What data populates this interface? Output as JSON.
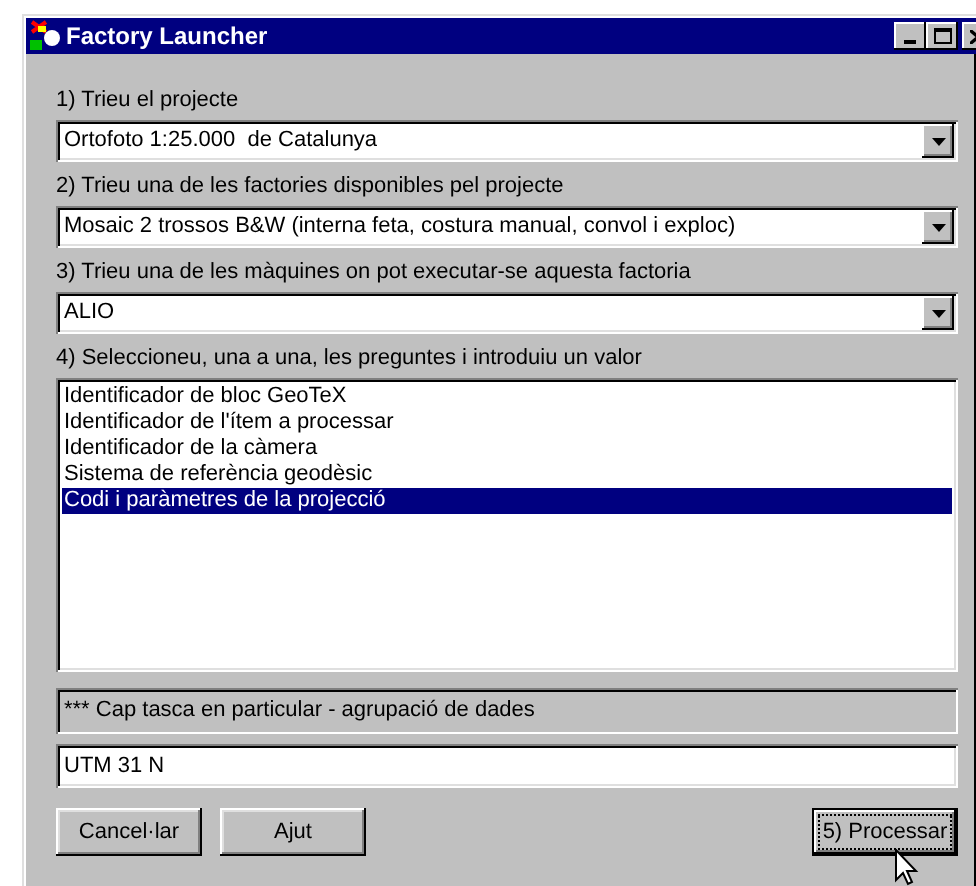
{
  "window": {
    "title": "Factory Launcher"
  },
  "steps": [
    {
      "kind": "combo",
      "label": "1) Trieu el projecte",
      "value": "Ortofoto 1:25.000  de Catalunya"
    },
    {
      "kind": "combo",
      "label": "2) Trieu una de les factories disponibles pel projecte",
      "value": "Mosaic 2 trossos B&W (interna feta, costura manual, convol i exploc)"
    },
    {
      "kind": "combo",
      "label": "3) Trieu una de les màquines on pot executar-se aquesta factoria",
      "value": "ALIO"
    },
    {
      "kind": "list",
      "label": "4) Seleccioneu, una a una, les preguntes i introduiu un valor",
      "items": [
        {
          "text": "Identificador de bloc GeoTeX",
          "selected": false
        },
        {
          "text": "Identificador de l'ítem a processar",
          "selected": false
        },
        {
          "text": "Identificador de la càmera",
          "selected": false
        },
        {
          "text": "Sistema de referència geodèsic",
          "selected": false
        },
        {
          "text": "Codi i paràmetres de la projecció",
          "selected": true
        }
      ]
    }
  ],
  "description": "*** Cap tasca en particular - agrupació de dades",
  "value_field": {
    "value": "UTM 31 N"
  },
  "buttons": [
    {
      "label": "Cancel·lar",
      "default": false
    },
    {
      "label": "Ajut",
      "default": false
    },
    {
      "label": "5) Processar",
      "default": true
    }
  ]
}
